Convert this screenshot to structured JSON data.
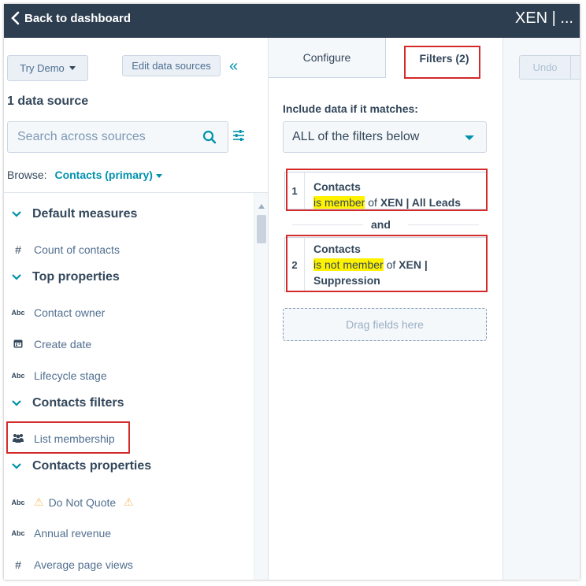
{
  "header": {
    "back_label": "Back to dashboard",
    "report_title": "XEN | ..."
  },
  "left_panel": {
    "try_demo_label": "Try Demo",
    "edit_sources_label": "Edit data sources",
    "collapse_glyph": "«",
    "data_source_count": "1 data source",
    "search_placeholder": "Search across sources",
    "browse_label": "Browse:",
    "browse_value": "Contacts (primary)",
    "sections": [
      {
        "title": "Default measures",
        "items": [
          {
            "type_icon": "#",
            "label": "Count of contacts"
          }
        ]
      },
      {
        "title": "Top properties",
        "items": [
          {
            "type_icon": "Abc",
            "label": "Contact owner"
          },
          {
            "type_icon": "calendar-icon",
            "label": "Create date"
          },
          {
            "type_icon": "Abc",
            "label": "Lifecycle stage"
          }
        ]
      },
      {
        "title": "Contacts filters",
        "items": [
          {
            "type_icon": "people-icon",
            "label": "List membership"
          }
        ]
      },
      {
        "title": "Contacts properties",
        "items": [
          {
            "type_icon": "Abc",
            "label": "Do Not Quote"
          },
          {
            "type_icon": "Abc",
            "label": "Annual revenue"
          },
          {
            "type_icon": "#",
            "label": "Average page views"
          }
        ]
      }
    ]
  },
  "tabs": {
    "configure": "Configure",
    "filters": "Filters (2)"
  },
  "filters": {
    "include_label": "Include data if it matches:",
    "match_mode": "ALL of the filters below",
    "items": [
      {
        "number": "1",
        "object": "Contacts",
        "operator": "is member",
        "connector": "of",
        "value": "XEN | All Leads"
      },
      {
        "number": "2",
        "object": "Contacts",
        "operator": "is not member",
        "connector": "of",
        "value_line1": "XEN |",
        "value_line2": "Suppression"
      }
    ],
    "joiner": "and",
    "drag_placeholder": "Drag fields here"
  },
  "toolbar": {
    "undo_label": "Undo"
  },
  "colors": {
    "header_bg": "#2d3e50",
    "accent": "#0091ae",
    "highlight": "#fff200",
    "annotation_red": "#d42a2a"
  }
}
